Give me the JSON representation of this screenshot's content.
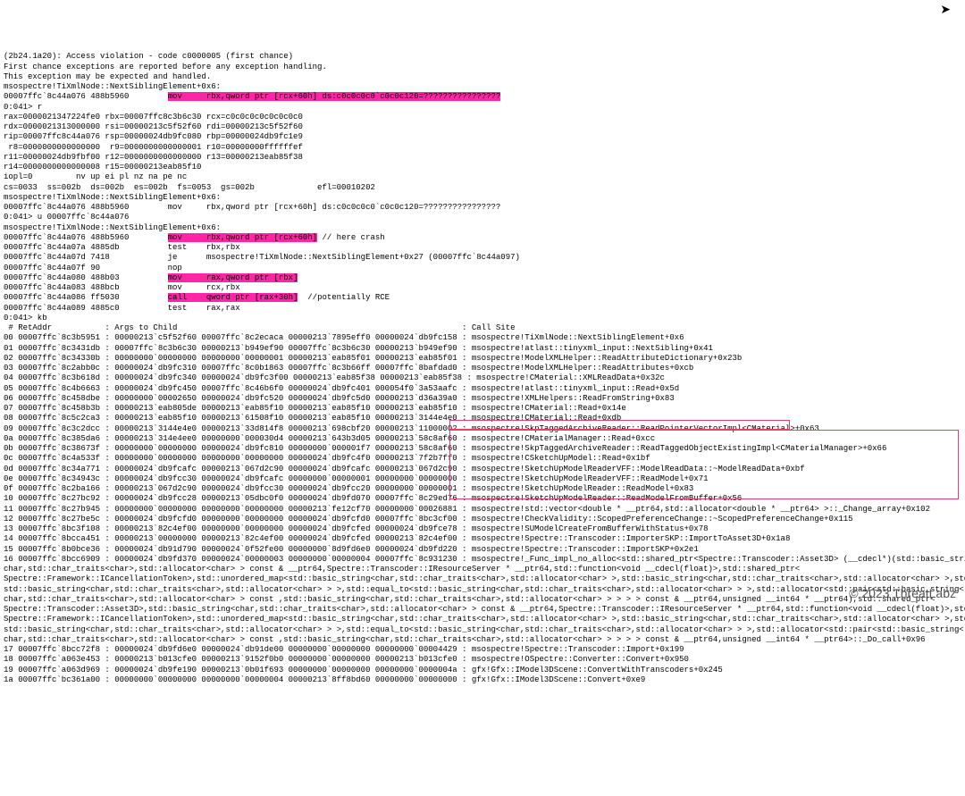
{
  "header": {
    "l1": "(2b24.1a20): Access violation - code c0000005 (first chance)",
    "l2": "First chance exceptions are reported before any exception handling.",
    "l3": "This exception may be expected and handled.",
    "l4": "msospectre!TiXmlNode::NextSiblingElement+0x6:",
    "l5_addr": "00007ffc`8c44a076 488b5960        ",
    "l5_hl": "mov     rbx,qword ptr [rcx+60h] ds:c0c0c0c0`c0c0c120=????????????????",
    "prompt1": "0:041> r"
  },
  "regs": {
    "r1": "rax=0000021347224fe0 rbx=00007ffc8c3b6c30 rcx=c0c0c0c0c0c0c0c0",
    "r2": "rdx=0000021313000000 rsi=00000213c5f52f60 rdi=00000213c5f52f60",
    "r3": "rip=00007ffc8c44a076 rsp=00000024db9fc080 rbp=00000024db9fc1e9",
    "r4": " r8=0000000000000000  r9=0000000000000001 r10=00000000ffffffef",
    "r5": "r11=00000024db9fbf00 r12=0000000000000000 r13=00000213eab85f38",
    "r6": "r14=0000000000000008 r15=00000213eab85f10",
    "r7": "iopl=0         nv up ei pl nz na pe nc",
    "r8l": "cs=0033  ss=002b  ds=002b  es=002b  fs=0053  gs=002b             efl=00010202",
    "r9l": "msospectre!TiXmlNode::NextSiblingElement+0x6:",
    "r10": "00007ffc`8c44a076 488b5960        mov     rbx,qword ptr [rcx+60h] ds:c0c0c0c0`c0c0c120=????????????????",
    "prompt2": "0:041> u 00007ffc`8c44a076",
    "r11": "msospectre!TiXmlNode::NextSiblingElement+0x6:"
  },
  "disasm": {
    "d1_a": "00007ffc`8c44a076 488b5960        ",
    "d1_h": "mov     rbx,qword ptr [rcx+60h]",
    "d1_c": " // here crash",
    "d2": "00007ffc`8c44a07a 4885db          test    rbx,rbx",
    "d3": "00007ffc`8c44a07d 7418            je      msospectre!TiXmlNode::NextSiblingElement+0x27 (00007ffc`8c44a097)",
    "d4": "00007ffc`8c44a07f 90              nop",
    "d5_a": "00007ffc`8c44a080 488b03          ",
    "d5_h": "mov     rax,qword ptr [rbx]",
    "d6": "00007ffc`8c44a083 488bcb          mov     rcx,rbx",
    "d7_a": "00007ffc`8c44a086 ff5030          ",
    "d7_h": "call    qword ptr [rax+30h]",
    "d7_c": "  //potentially RCE",
    "d8": "00007ffc`8c44a089 4885c0          test    rax,rax",
    "prompt3": "0:041> kb"
  },
  "stack_hdr": " # RetAddr           : Args to Child                                                           : Call Site",
  "stack": [
    "00 00007ffc`8c3b5951 : 00000213`c5f52f60 00007ffc`8c2ecaca 00000213`7895eff0 00000024`db9fc158 : msospectre!TiXmlNode::NextSiblingElement+0x6",
    "01 00007ffc`8c3431db : 00007ffc`8c3b6c30 00000213`b949ef90 00007ffc`8c3b6c30 00000213`b949ef90 : msospectre!atlast::tinyxml_input::NextSibling+0x41",
    "02 00007ffc`8c34330b : 00000000`00000000 00000000`00000001 00000213`eab85f01 00000213`eab85f01 : msospectre!ModelXMLHelper::ReadAttributeDictionary+0x23b",
    "03 00007ffc`8c2abb0c : 00000024`db9fc310 00007ffc`8c0b1863 00007ffc`8c3b66ff 00007ffc`8bafdad0 : msospectre!ModelXMLHelper::ReadAttributes+0xcb",
    "04 00007ffc`8c3b618d : 00000024`db9fc340 00000024`db9fc3f00 00000213`eab85f38 00000213`eab85f38 : msospectre!CMaterial::XMLReadData+0x32c",
    "05 00007ffc`8c4b6663 : 00000024`db9fc450 00007ffc`8c46b6f0 00000024`db9fc401 000054f0`3a53aafc : msospectre!atlast::tinyxml_input::Read+0x5d",
    "06 00007ffc`8c458dbe : 00000000`00002650 00000024`db9fc520 00000024`db9fc5d0 00000213`d36a39a0 : msospectre!XMLHelpers::ReadFromString+0x83",
    "07 00007ffc`8c458b3b : 00000213`eab805de 00000213`eab85f10 00000213`eab85f10 00000213`eab85f10 : msospectre!CMaterial::Read+0x14e",
    "08 00007ffc`8c5c2ca3 : 00000213`eab85f10 00000213`61508f10 00000213`eab85f10 00000213`3144e4e0 : msospectre!CMaterial::Read+0xdb",
    "09 00007ffc`8c3c2dcc : 00000213`3144e4e0 00000213`33d814f8 00000213`698cbf20 00000213`11000002 : msospectre!SkpTaggedArchiveReader::ReadPointerVectorImpl<CMaterial>+0x63",
    "0a 00007ffc`8c385da6 : 00000213`314e4ee0 00000000`000030d4 00000213`643b3d05 00000213`58c8af60 : msospectre!CMaterialManager::Read+0xcc",
    "0b 00007ffc`8c38673f : 00000000`00000000 00000024`db9fc810 00000000`000001f7 00000213`58c8af60 : msospectre!SkpTaggedArchiveReader::ReadTaggedObjectExistingImpl<CMaterialManager>+0x66",
    "0c 00007ffc`8c4a533f : 00000000`00000000 00000000`00000000 00000024`db9fc4f0 00000213`7f2b7ff0 : msospectre!CSketchUpModel::Read+0x1bf",
    "0d 00007ffc`8c34a771 : 00000024`db9fcafc 00000213`067d2c90 00000024`db9fcafc 00000213`067d2c90 : ",
    "0e 00007ffc`8c34943c : 00000024`db9fcc30 00000024`db9fcafc 00000000`00000001 00000000`00000000 : msospectre!SketchUpModelReaderVFF::ReadModel+0x71",
    "0f 00007ffc`8c2ba166 : 00000213`067d2c90 00000024`db9fcc30 00000024`db9fcc20 00000000`00000001 : msospectre!SketchUpModelReader::ReadModel+0x83",
    "10 00007ffc`8c27bc92 : 00000024`db9fcc28 00000213`05dbc0f0 00000024`db9fd070 00007ffc`8c29ed76 : msospectre!SketchUpModelReader::ReadModelFromBuffer+0x56",
    "11 00007ffc`8c27b945 : 00000000`00000000 00000000`00000000 00000213`fe12cf70 00000000`00026881 : msospectre!std::vector<double * __ptr64,std::allocator<double * __ptr64> >::_Change_array+0x102",
    "12 00007ffc`8c27be5c : 00000024`db9fcfd0 00000000`00000000 00000024`db9fcfd0 00007ffc`8bc3cf00 : msospectre!CheckValidity::ScopedPreferenceChange::~ScopedPreferenceChange+0x115",
    "13 00007ffc`8bc3f108 : 00000213`82c4ef00 00000000`00000000 00000024`db9fcfed 00000024`db9fce78 : msospectre!SUModelCreateFromBufferWithStatus+0x78",
    "14 00007ffc`8bcca451 : 00000213`00000000 00000213`82c4ef00 00000024`db9fcfed 00000213`82c4ef00 : ",
    "15 00007ffc`8b0bce36 : 00000024`db91d790 00000024`0f52fe00 00000000`8d9fd6e0 00000024`db9fd220 : msospectre!Spectre::Transcoder::ImportSKP+0x2e1"
  ],
  "boxed": {
    "b1": "msospectre!SketchUpModelReaderVFF::ModelReadData::~ModelReadData+0xbf",
    "b2": "msospectre!Spectre::Transcoder::ImporterSKP::ImportToAsset3D+0x1a8"
  },
  "tail": {
    "t1": "16 00007ffc`8bcc6909 : 00000024`db9fd370 00000024`00000003 00000000`00000004 00007ffc`8c931230 : msospectre!_Func_impl_no_alloc<std::shared_ptr<Spectre::Transcoder::Asset3D> (__cdecl*)(std::basic_string<",
    "t2": "char,std::char_traits<char>,std::allocator<char> > const & __ptr64,Spectre::Transcoder::IResourceServer * __ptr64,std::function<void __cdecl(float)>,std::shared_ptr<",
    "t3": "Spectre::Framework::ICancellationToken>,std::unordered_map<std::basic_string<char,std::char_traits<char>,std::allocator<char> >,std::basic_string<char,std::char_traits<char>,std::allocator<char> >,std::hash<",
    "t4": "std::basic_string<char,std::char_traits<char>,std::allocator<char> > >,std::equal_to<std::basic_string<char,std::char_traits<char>,std::allocator<char> > >,std::allocator<std::pair<std::basic_string<",
    "t5": "char,std::char_traits<char>,std::allocator<char> > const ,std::basic_string<char,std::char_traits<char>,std::allocator<char> > > > > const & __ptr64,unsigned __int64 * __ptr64),std::shared_ptr<",
    "t6": "Spectre::Transcoder::Asset3D>,std::basic_string<char,std::char_traits<char>,std::allocator<char> > const & __ptr64,Spectre::Transcoder::IResourceServer * __ptr64,std::function<void __cdecl(float)>,std::shared_ptr<",
    "t7": "Spectre::Framework::ICancellationToken>,std::unordered_map<std::basic_string<char,std::char_traits<char>,std::allocator<char> >,std::basic_string<char,std::char_traits<char>,std::allocator<char> >,std::hash<",
    "t8": "std::basic_string<char,std::char_traits<char>,std::allocator<char> > >,std::equal_to<std::basic_string<char,std::char_traits<char>,std::allocator<char> > >,std::allocator<std::pair<std::basic_string<",
    "t9": "char,std::char_traits<char>,std::allocator<char> > const ,std::basic_string<char,std::char_traits<char>,std::allocator<char> > > > > const & __ptr64,unsigned __int64 * __ptr64>::_Do_call+0x96",
    "t10": "17 00007ffc`8bcc72f8 : 00000024`db9fd6e0 00000024`db91de00 00000000`00000000 00000000`00004429 : msospectre!Spectre::Transcoder::Import+0x199",
    "t11": "18 00007ffc`a063e453 : 00000213`b013cfe0 00000213`9152f0b0 00000000`00000000 00000213`b013cfe0 : msospectre!OSpectre::Converter::Convert+0x950",
    "t12": "19 00007ffc`a063d969 : 00000024`db9fe190 00000213`0b01f693 00000000`00000000 00000000`0000004a : gfx!Gfx::IModel3DScene::ConvertWithTranscoders+0x245",
    "t13": "1a 00007ffc`bc361a00 : 00000000`00000000 00000000`00000004 00000213`8ff8bd60 00000000`00000000 : gfx!Gfx::IModel3DScene::Convert+0xe9"
  },
  "copyright": "© 2023 ThreatLabz"
}
